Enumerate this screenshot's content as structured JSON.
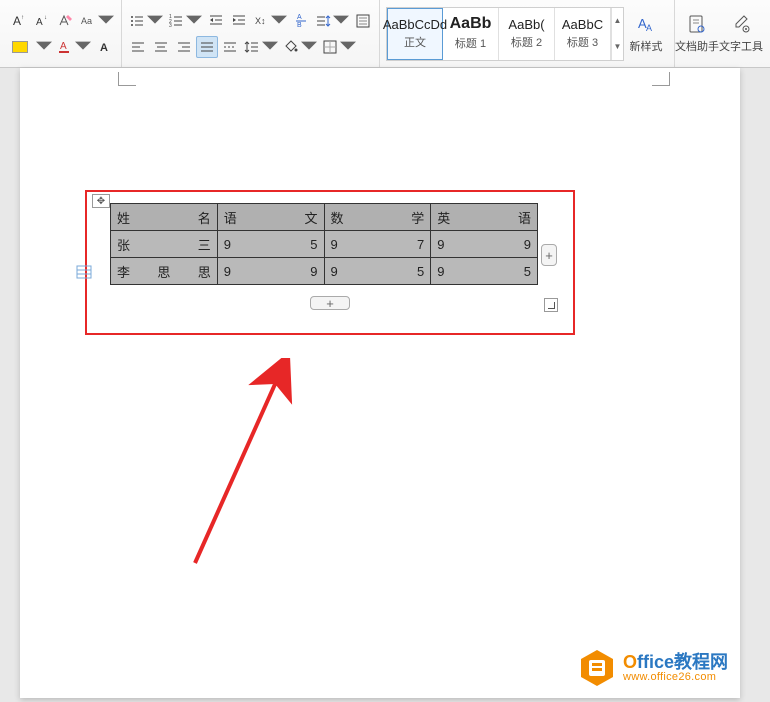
{
  "ribbon": {
    "styles_gallery": [
      {
        "preview": "AaBbCcDd",
        "label": "正文",
        "selected": true,
        "bold": false
      },
      {
        "preview": "AaBb",
        "label": "标题 1",
        "selected": false,
        "bold": true
      },
      {
        "preview": "AaBb(",
        "label": "标题 2",
        "selected": false,
        "bold": false
      },
      {
        "preview": "AaBbC",
        "label": "标题 3",
        "selected": false,
        "bold": false
      }
    ],
    "new_style_label": "新样式",
    "doc_assistant_label": "文档助手",
    "text_tools_label": "文字工具"
  },
  "table": {
    "headers": [
      {
        "left": "姓",
        "right": "名"
      },
      {
        "left": "语",
        "right": "文"
      },
      {
        "left": "数",
        "right": "学"
      },
      {
        "left": "英",
        "right": "语"
      }
    ],
    "rows": [
      [
        {
          "left": "张",
          "right": "三"
        },
        {
          "left": "9",
          "right": "5"
        },
        {
          "left": "9",
          "right": "7"
        },
        {
          "left": "9",
          "right": "9"
        }
      ],
      [
        {
          "left": "李",
          "mid": "思",
          "right": "思"
        },
        {
          "left": "9",
          "right": "9"
        },
        {
          "left": "9",
          "right": "5"
        },
        {
          "left": "9",
          "right": "5"
        }
      ]
    ],
    "add_col_glyph": "+",
    "add_row_glyph": "+",
    "anchor_glyph": "✥"
  },
  "watermark": {
    "brand_first": "O",
    "brand_rest": "ffice教程网",
    "url": "www.office26.com"
  }
}
